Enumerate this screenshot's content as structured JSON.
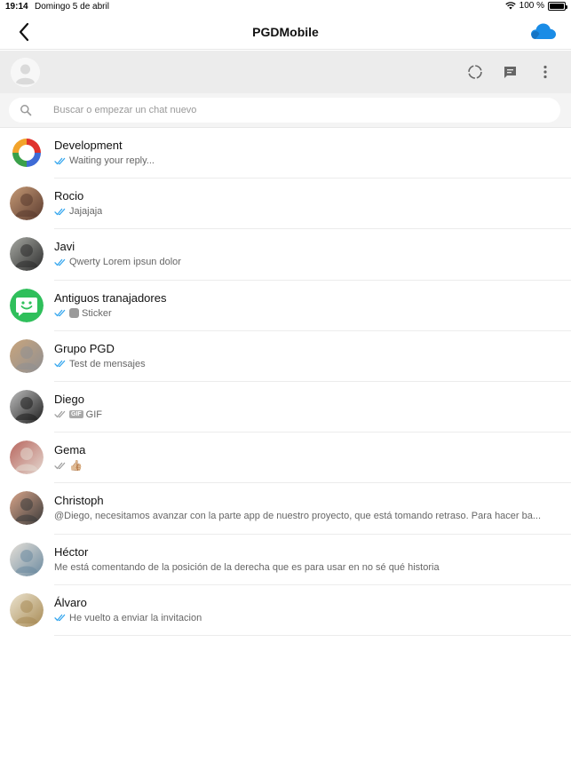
{
  "status_bar": {
    "time": "19:14",
    "date": "Domingo 5 de abril",
    "battery_text": "100 %"
  },
  "nav": {
    "title": "PGDMobile"
  },
  "search": {
    "placeholder": "Buscar o empezar un chat nuevo"
  },
  "colors": {
    "accent": "#1a8ce6",
    "tick_read": "#34a6ee",
    "tick_unread": "#a0a0a0",
    "toolbar_bg": "#ececec"
  },
  "chats": [
    {
      "name": "Development",
      "preview": "Waiting your reply...",
      "ticks": "read",
      "badge": "",
      "avatar_icon": "development-logo"
    },
    {
      "name": "Rocio",
      "preview": "Jajajaja",
      "ticks": "read",
      "badge": "",
      "avatar_icon": "photo"
    },
    {
      "name": "Javi",
      "preview": "Qwerty Lorem ipsun dolor",
      "ticks": "read",
      "badge": "",
      "avatar_icon": "photo"
    },
    {
      "name": "Antiguos tranajadores",
      "preview": "Sticker",
      "ticks": "read",
      "badge": "sticker",
      "avatar_icon": "smiley-chat"
    },
    {
      "name": "Grupo PGD",
      "preview": "Test de mensajes",
      "ticks": "read",
      "badge": "",
      "avatar_icon": "photo"
    },
    {
      "name": "Diego",
      "preview": "GIF",
      "ticks": "unread",
      "badge": "gif",
      "badge_text": "GIF",
      "avatar_icon": "photo"
    },
    {
      "name": "Gema",
      "preview": "👍🏼",
      "ticks": "unread",
      "badge": "",
      "avatar_icon": "photo"
    },
    {
      "name": "Christoph",
      "preview": "@Diego, necesitamos avanzar con la parte app de nuestro proyecto, que está tomando retraso. Para hacer ba...",
      "ticks": "",
      "badge": "",
      "avatar_icon": "photo"
    },
    {
      "name": "Héctor",
      "preview": "Me está comentando de la posición de la derecha que es para usar en no sé qué historia",
      "ticks": "",
      "badge": "",
      "avatar_icon": "photo"
    },
    {
      "name": "Álvaro",
      "preview": "He vuelto a enviar la invitacion",
      "ticks": "read",
      "badge": "",
      "avatar_icon": "photo"
    }
  ]
}
